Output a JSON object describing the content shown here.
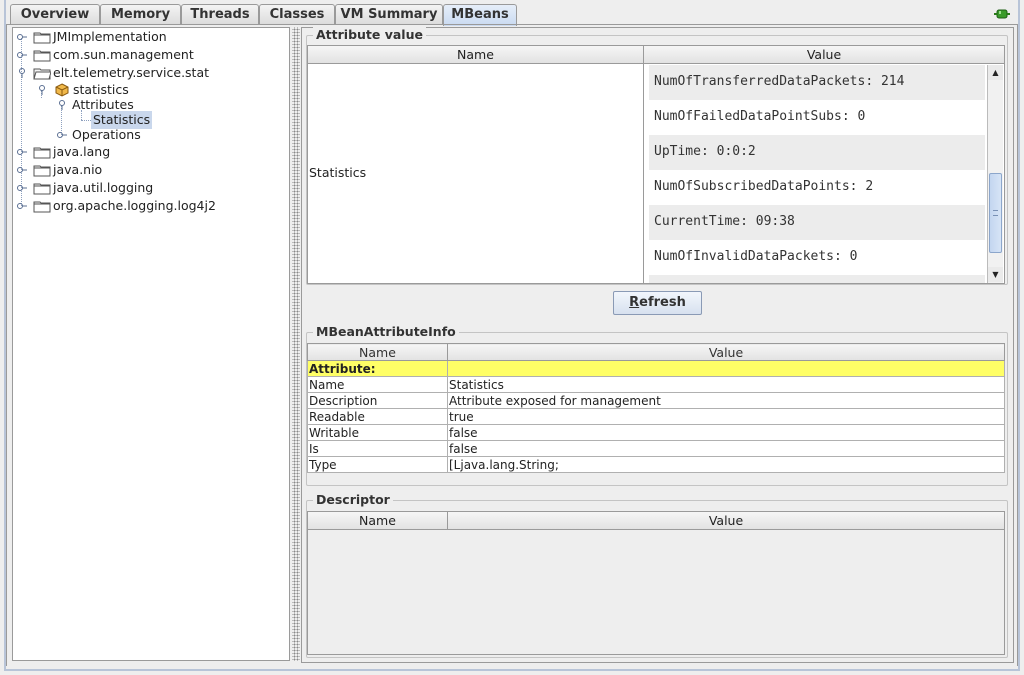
{
  "tabs": [
    {
      "label": "Overview",
      "selected": false
    },
    {
      "label": "Memory",
      "selected": false
    },
    {
      "label": "Threads",
      "selected": false
    },
    {
      "label": "Classes",
      "selected": false
    },
    {
      "label": "VM Summary",
      "selected": false
    },
    {
      "label": "MBeans",
      "selected": true
    }
  ],
  "tree": {
    "nodes": [
      {
        "label": "JMImplementation",
        "type": "folder"
      },
      {
        "label": "com.sun.management",
        "type": "folder"
      },
      {
        "label": "elt.telemetry.service.stat",
        "type": "folder",
        "expanded": true
      },
      {
        "label": "statistics",
        "type": "bean",
        "expanded": true
      },
      {
        "label": "Attributes",
        "type": "group",
        "expanded": true
      },
      {
        "label": "Statistics",
        "type": "leaf",
        "selected": true
      },
      {
        "label": "Operations",
        "type": "group"
      },
      {
        "label": "java.lang",
        "type": "folder"
      },
      {
        "label": "java.nio",
        "type": "folder"
      },
      {
        "label": "java.util.logging",
        "type": "folder"
      },
      {
        "label": "org.apache.logging.log4j2",
        "type": "folder"
      }
    ]
  },
  "attribute_value": {
    "title": "Attribute value",
    "col_name": "Name",
    "col_value": "Value",
    "name": "Statistics",
    "values": [
      "NumOfTransferredDataPackets: 214",
      "NumOfFailedDataPointSubs: 0",
      "UpTime: 0:0:2",
      "NumOfSubscribedDataPoints: 2",
      "CurrentTime: 09:38",
      "NumOfInvalidDataPackets: 0"
    ]
  },
  "refresh": {
    "label": "Refresh",
    "mnemonic": "R",
    "rest": "efresh"
  },
  "mbean_info": {
    "title": "MBeanAttributeInfo",
    "col_name": "Name",
    "col_value": "Value",
    "header_row": "Attribute:",
    "rows": [
      {
        "name": "Name",
        "value": "Statistics"
      },
      {
        "name": "Description",
        "value": "Attribute exposed for management"
      },
      {
        "name": "Readable",
        "value": "true"
      },
      {
        "name": "Writable",
        "value": "false"
      },
      {
        "name": "Is",
        "value": "false"
      },
      {
        "name": "Type",
        "value": "[Ljava.lang.String;"
      }
    ]
  },
  "descriptor": {
    "title": "Descriptor",
    "col_name": "Name",
    "col_value": "Value"
  },
  "colors": {
    "highlight_row": "#ffff66",
    "selection": "#c9d7ec",
    "tab_selected": "#c9daf1"
  }
}
